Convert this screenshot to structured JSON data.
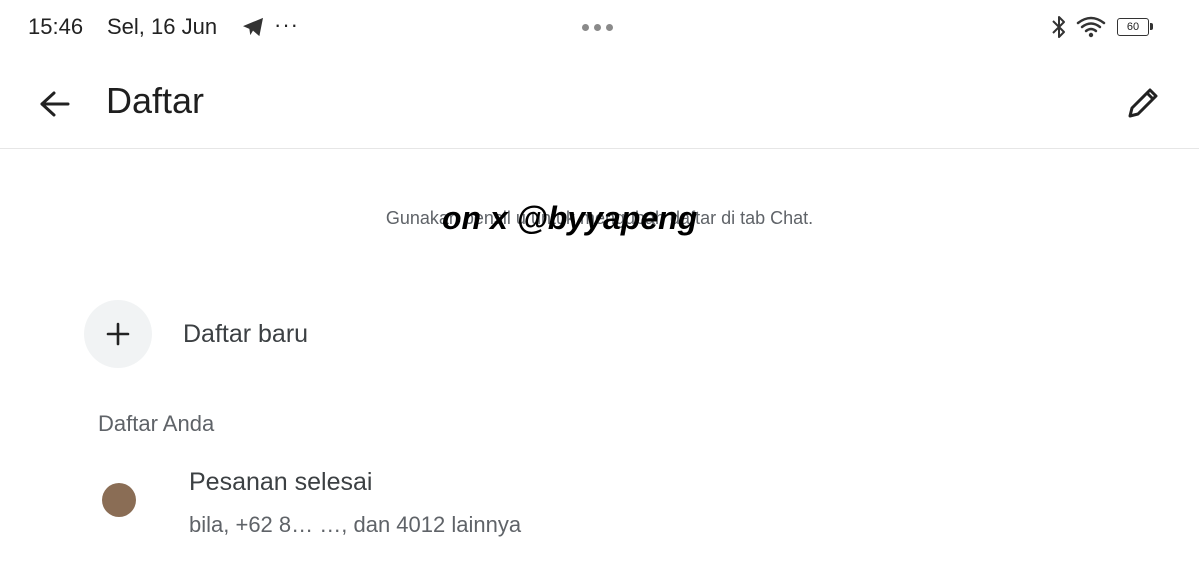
{
  "status": {
    "time": "15:46",
    "date": "Sel, 16 Jun",
    "notification_more": "···",
    "battery": "60"
  },
  "app_bar": {
    "title": "Daftar"
  },
  "hint": "Gunakan pensil u     untuk mengubah daftar di tab Chat.",
  "watermark": "on x @byyapeng",
  "new_list": {
    "label": "Daftar baru"
  },
  "section": {
    "label": "Daftar Anda"
  },
  "lists": [
    {
      "title": "Pesanan selesai",
      "subtitle": "bila, +62 8… …, dan 4012 lainnya",
      "color": "#8a6d55"
    }
  ],
  "colors": {
    "background": "#ffffff",
    "text_primary": "#1f1f1f",
    "text_secondary": "#5f6368",
    "plus_circle_bg": "#f1f3f4"
  },
  "icons": {
    "back": "arrow-left-icon",
    "edit": "pencil-icon",
    "add": "plus-icon",
    "telegram": "telegram-icon",
    "bluetooth": "bluetooth-icon",
    "wifi": "wifi-icon",
    "battery": "battery-icon"
  }
}
